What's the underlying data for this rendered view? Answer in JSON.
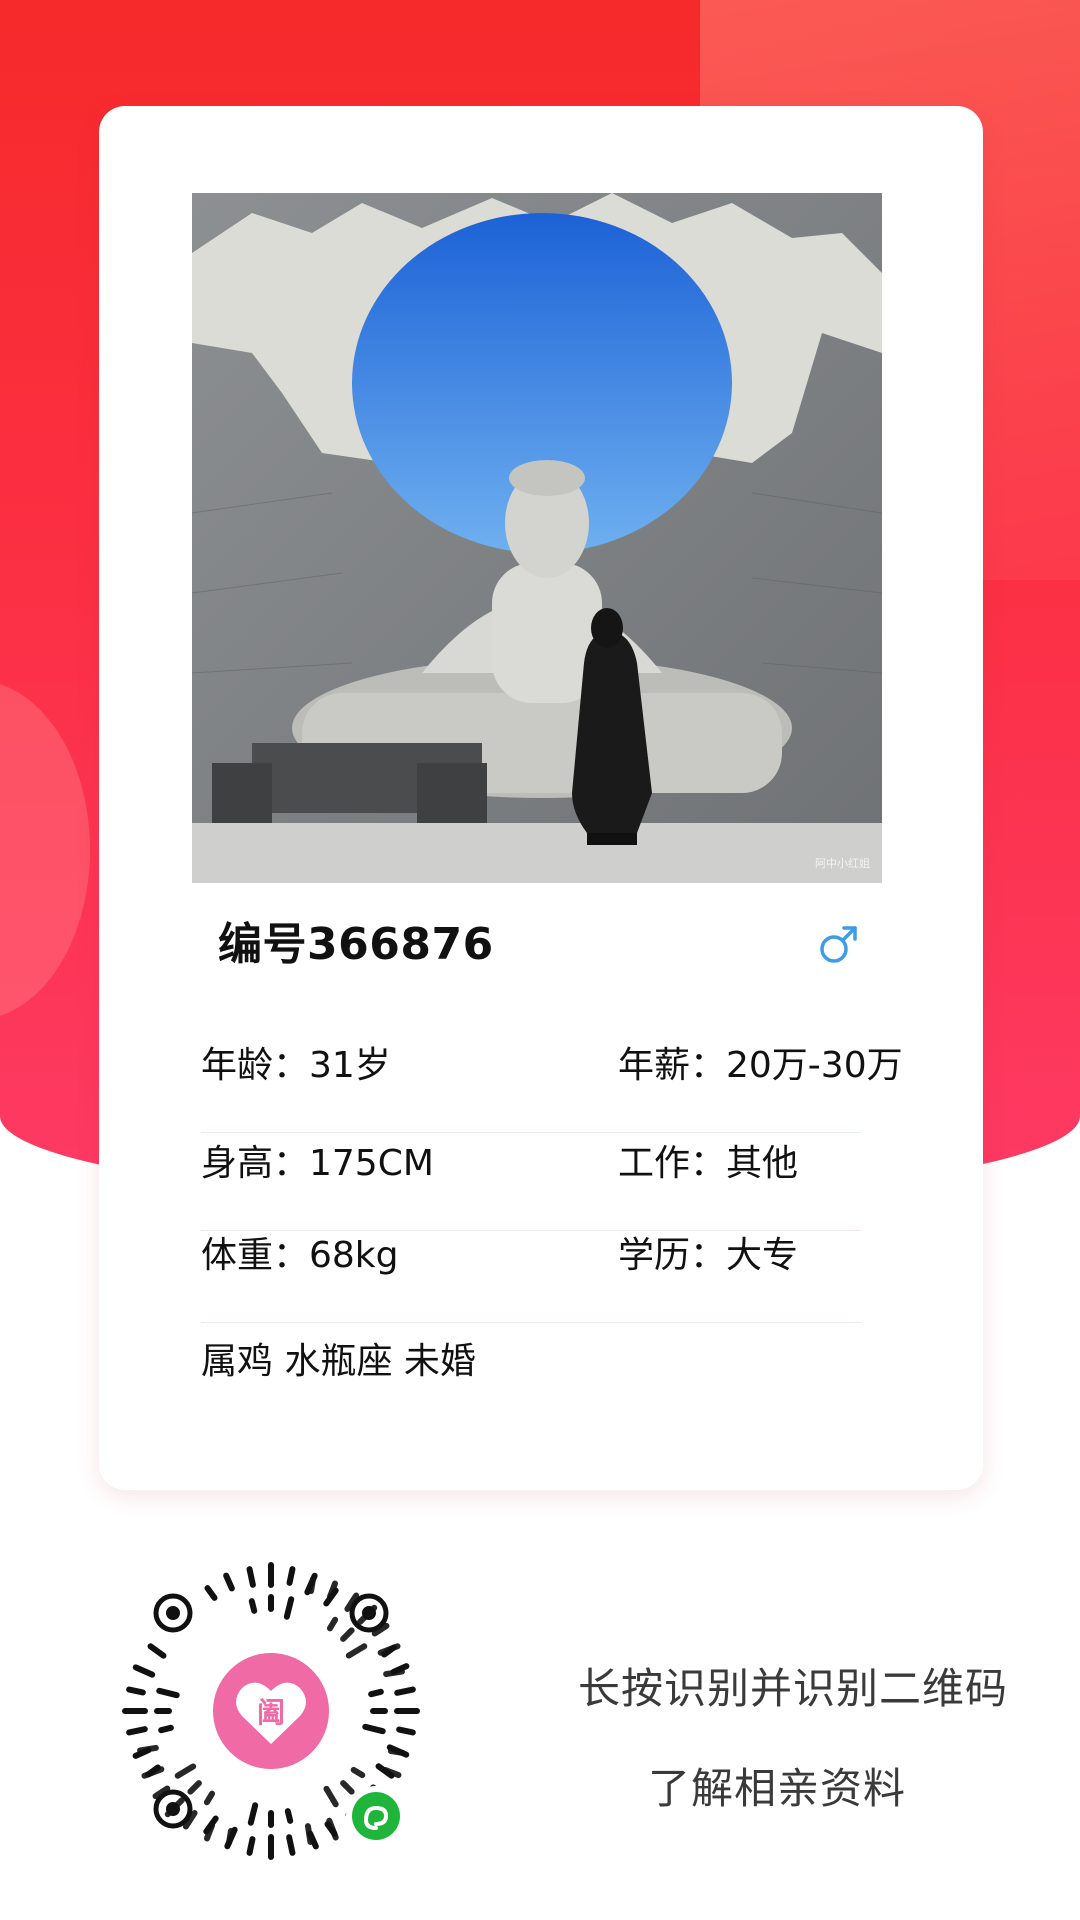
{
  "profile": {
    "id_label": "编号366876",
    "gender_icon": "male-symbol-icon",
    "photo_watermark": "阿中小红姐",
    "rows": [
      {
        "left": "年龄：31岁",
        "right": "年薪：20万-30万"
      },
      {
        "left": "身高：175CM",
        "right": "工作：其他"
      },
      {
        "left": "体重：68kg",
        "right": "学历：大专"
      }
    ],
    "tags": "属鸡 水瓶座 未婚"
  },
  "cta": {
    "line1": "长按识别并识别二维码",
    "line2": "了解相亲资料"
  },
  "colors": {
    "brand_red": "#f62a2a",
    "brand_pink": "#fe3a64",
    "gender_blue": "#3d9be9",
    "qr_center_pink": "#f06aa6",
    "miniprogram_green": "#1fb53b"
  }
}
